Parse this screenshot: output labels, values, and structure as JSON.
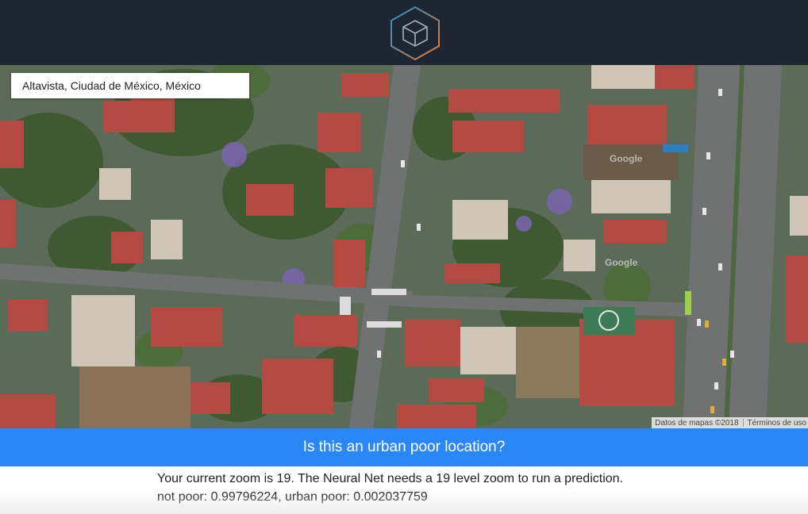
{
  "header": {
    "logo_icon": "cube-icon",
    "logo_colors": [
      "#1e8fd6",
      "#f07b2c"
    ]
  },
  "map": {
    "address": "Altavista, Ciudad de México, México",
    "watermarks": [
      "Google",
      "Google"
    ],
    "attribution": {
      "data": "Datos de mapas ©2018",
      "terms": "Términos de uso"
    }
  },
  "question": {
    "text": "Is this an urban poor location?",
    "background": "#2b86f6"
  },
  "results": {
    "zoom_message": "Your current zoom is 19. The Neural Net needs a 19 level zoom to run a prediction.",
    "prediction": "not poor: 0.99796224, urban poor: 0.002037759"
  }
}
